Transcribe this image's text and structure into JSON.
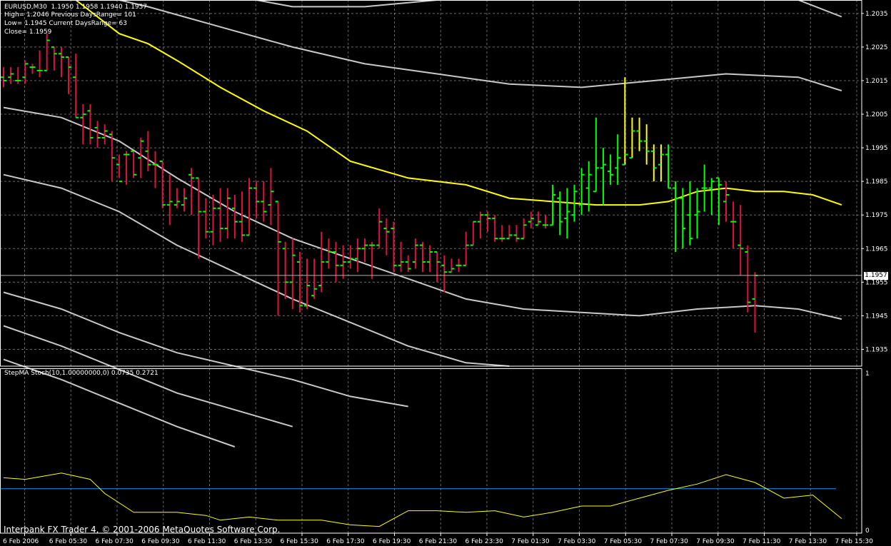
{
  "header": {
    "symbol_line": "EURUSD,M30  1.1950 1.1958 1.1940 1.1957",
    "high_line": "High= 1.2046 Previous DaysRange= 101",
    "low_line": "Low= 1.1945 Current DaysRange= 63",
    "close_line": "Close= 1.1959"
  },
  "indicator": {
    "title": "StepMA Stoch(10,1.00000000,0) 0.0735 0.2721"
  },
  "footer": {
    "copyright": "Interbank FX Trader 4, © 2001-2006 MetaQuotes Software Corp."
  },
  "current_price": "1.1957",
  "colors": {
    "background": "#000000",
    "grid": "#c0c0c0",
    "bull": "#00ff00",
    "bear": "#dc143c",
    "neutral": "#ffff00",
    "bands": "#c8c8c8",
    "ma": "#ffff00",
    "stoch": "#ffff00",
    "level": "#1e90ff"
  },
  "chart_data": [
    {
      "type": "ohlc",
      "price_labels": [
        "1.2035",
        "1.2025",
        "1.2015",
        "1.2005",
        "1.1995",
        "1.1985",
        "1.1975",
        "1.1965",
        "1.1955",
        "1.1945",
        "1.1935"
      ],
      "time_labels": [
        "6 Feb 2006",
        "6 Feb 05:30",
        "6 Feb 07:30",
        "6 Feb 09:30",
        "6 Feb 11:30",
        "6 Feb 13:30",
        "6 Feb 15:30",
        "6 Feb 17:30",
        "6 Feb 19:30",
        "6 Feb 21:30",
        "6 Feb 23:30",
        "7 Feb 01:30",
        "7 Feb 03:30",
        "7 Feb 05:30",
        "7 Feb 07:30",
        "7 Feb 09:30",
        "7 Feb 11:30",
        "7 Feb 13:30",
        "7 Feb 15:30"
      ],
      "ylim": [
        1.193,
        1.2039
      ],
      "bars": [
        [
          1.2016,
          1.2019,
          1.2013,
          1.2015,
          "bear"
        ],
        [
          1.2016,
          1.2019,
          1.2014,
          1.2017,
          "bear"
        ],
        [
          1.2015,
          1.2019,
          1.2014,
          1.2015,
          "bear"
        ],
        [
          1.2016,
          1.2021,
          1.2014,
          1.202,
          "bear"
        ],
        [
          1.2019,
          1.202,
          1.2017,
          1.2019,
          "bear"
        ],
        [
          1.2018,
          1.2024,
          1.2016,
          1.2018,
          "bear"
        ],
        [
          1.2018,
          1.2029,
          1.2018,
          1.2027,
          "bear"
        ],
        [
          1.2025,
          1.2025,
          1.2018,
          1.2023,
          "bear"
        ],
        [
          1.2023,
          1.2025,
          1.2016,
          1.2022,
          "bear"
        ],
        [
          1.2022,
          1.2022,
          1.2011,
          1.2019,
          "bear"
        ],
        [
          1.2016,
          1.2023,
          1.2004,
          1.2004,
          "bear"
        ],
        [
          1.2004,
          1.2008,
          1.1996,
          1.2005,
          "bear"
        ],
        [
          1.2006,
          1.2008,
          1.1996,
          1.1998,
          "bear"
        ],
        [
          1.2001,
          1.2003,
          1.1995,
          1.1998,
          "bear"
        ],
        [
          1.1998,
          1.2002,
          1.1996,
          1.2,
          "bear"
        ],
        [
          1.1999,
          1.2,
          1.1985,
          1.1992,
          "bear"
        ],
        [
          1.199,
          1.1993,
          1.1986,
          1.1985,
          "bear"
        ],
        [
          1.1993,
          1.1994,
          1.1984,
          1.1993,
          "bear"
        ],
        [
          1.1994,
          1.1994,
          1.1986,
          1.1987,
          "bear"
        ],
        [
          1.1992,
          1.1998,
          1.1986,
          1.1997,
          "bear"
        ],
        [
          1.1994,
          1.2,
          1.1988,
          1.199,
          "bear"
        ],
        [
          1.199,
          1.1994,
          1.1983,
          1.199,
          "bear"
        ],
        [
          1.1991,
          1.1991,
          1.1977,
          1.1978,
          "bear"
        ],
        [
          1.1978,
          1.1987,
          1.1972,
          1.1979,
          "bear"
        ],
        [
          1.1978,
          1.1983,
          1.1977,
          1.1979,
          "bear"
        ],
        [
          1.1978,
          1.1983,
          1.1976,
          1.198,
          "bear"
        ],
        [
          1.1987,
          1.1989,
          1.1975,
          1.1986,
          "bear"
        ],
        [
          1.1986,
          1.1986,
          1.1962,
          1.1976,
          "bear"
        ],
        [
          1.1976,
          1.198,
          1.1968,
          1.197,
          "bear"
        ],
        [
          1.197,
          1.1981,
          1.1966,
          1.1977,
          "bear"
        ],
        [
          1.1977,
          1.1983,
          1.1967,
          1.1971,
          "bear"
        ],
        [
          1.1971,
          1.1983,
          1.1968,
          1.198,
          "bear"
        ],
        [
          1.1977,
          1.1981,
          1.1968,
          1.1973,
          "bear"
        ],
        [
          1.1973,
          1.1982,
          1.1967,
          1.1969,
          "bear"
        ],
        [
          1.1969,
          1.1986,
          1.1969,
          1.1983,
          "bear"
        ],
        [
          1.1983,
          1.1985,
          1.1974,
          1.1979,
          "bear"
        ],
        [
          1.1979,
          1.1985,
          1.1973,
          1.1976,
          "bear"
        ],
        [
          1.1978,
          1.1989,
          1.1972,
          1.1982,
          "bear"
        ],
        [
          1.1979,
          1.1979,
          1.1945,
          1.1967,
          "bear"
        ],
        [
          1.1965,
          1.1967,
          1.195,
          1.1955,
          "bear"
        ],
        [
          1.1955,
          1.1968,
          1.1947,
          1.1963,
          "bear"
        ],
        [
          1.1961,
          1.1964,
          1.1946,
          1.1948,
          "bear"
        ],
        [
          1.1948,
          1.1962,
          1.1947,
          1.1954,
          "bear"
        ],
        [
          1.1951,
          1.1962,
          1.195,
          1.1953,
          "bear"
        ],
        [
          1.1954,
          1.197,
          1.1952,
          1.1961,
          "bear"
        ],
        [
          1.1961,
          1.1968,
          1.1959,
          1.1964,
          "bear"
        ],
        [
          1.1964,
          1.1967,
          1.1955,
          1.196,
          "bear"
        ],
        [
          1.196,
          1.1966,
          1.1956,
          1.1961,
          "bear"
        ],
        [
          1.1961,
          1.1966,
          1.1959,
          1.1962,
          "bear"
        ],
        [
          1.1962,
          1.1968,
          1.1958,
          1.1965,
          "bear"
        ],
        [
          1.1965,
          1.1968,
          1.1961,
          1.1966,
          "bear"
        ],
        [
          1.1966,
          1.1967,
          1.1956,
          1.1966,
          "bear"
        ],
        [
          1.1966,
          1.1977,
          1.1965,
          1.1973,
          "bear"
        ],
        [
          1.1971,
          1.1974,
          1.1963,
          1.197,
          "bear"
        ],
        [
          1.1971,
          1.1973,
          1.1958,
          1.196,
          "bear"
        ],
        [
          1.196,
          1.1967,
          1.1958,
          1.1961,
          "bear"
        ],
        [
          1.1961,
          1.1963,
          1.1958,
          1.1959,
          "bear"
        ],
        [
          1.1961,
          1.1968,
          1.1959,
          1.1966,
          "bear"
        ],
        [
          1.1966,
          1.1967,
          1.1958,
          1.1961,
          "bear"
        ],
        [
          1.1961,
          1.1966,
          1.1958,
          1.1964,
          "bear"
        ],
        [
          1.1964,
          1.1964,
          1.1955,
          1.1961,
          "bear"
        ],
        [
          1.196,
          1.1963,
          1.1952,
          1.1958,
          "bear"
        ],
        [
          1.1958,
          1.1962,
          1.1958,
          1.1959,
          "bear"
        ],
        [
          1.196,
          1.1962,
          1.1958,
          1.196,
          "bear"
        ],
        [
          1.196,
          1.197,
          1.196,
          1.1966,
          "bear"
        ],
        [
          1.1966,
          1.1973,
          1.1966,
          1.1973,
          "bear"
        ],
        [
          1.1973,
          1.1976,
          1.1968,
          1.1975,
          "bear"
        ],
        [
          1.1975,
          1.1976,
          1.197,
          1.1974,
          "bear"
        ],
        [
          1.1974,
          1.1975,
          1.1967,
          1.1968,
          "bear"
        ],
        [
          1.1968,
          1.1972,
          1.1967,
          1.1968,
          "bear"
        ],
        [
          1.1968,
          1.1972,
          1.1968,
          1.1969,
          "bear"
        ],
        [
          1.1969,
          1.1972,
          1.1967,
          1.1968,
          "bear"
        ],
        [
          1.1968,
          1.1974,
          1.1968,
          1.1972,
          "bear"
        ],
        [
          1.1973,
          1.1976,
          1.1971,
          1.1974,
          "bear"
        ],
        [
          1.1972,
          1.1976,
          1.1972,
          1.1973,
          "bear"
        ],
        [
          1.1972,
          1.1975,
          1.1971,
          1.1972,
          "bear"
        ],
        [
          1.1972,
          1.1984,
          1.1972,
          1.1981,
          "bull"
        ],
        [
          1.198,
          1.1982,
          1.1969,
          1.1973,
          "bull"
        ],
        [
          1.1974,
          1.1983,
          1.1968,
          1.1976,
          "bull"
        ],
        [
          1.1975,
          1.1984,
          1.1973,
          1.1982,
          "bull"
        ],
        [
          1.1978,
          1.1989,
          1.1975,
          1.1987,
          "bull"
        ],
        [
          1.1983,
          1.1991,
          1.1976,
          1.1987,
          "bull"
        ],
        [
          1.1982,
          1.2004,
          1.1982,
          1.1989,
          "bull"
        ],
        [
          1.1989,
          1.1995,
          1.1978,
          1.199,
          "bull"
        ],
        [
          1.1988,
          1.1993,
          1.1984,
          1.1987,
          "bull"
        ],
        [
          1.1989,
          1.1999,
          1.1984,
          1.1992,
          "bull"
        ],
        [
          1.199,
          1.2016,
          1.199,
          1.1993,
          "neutral"
        ],
        [
          1.1992,
          1.2004,
          1.1992,
          1.2,
          "neutral"
        ],
        [
          1.2,
          1.2004,
          1.1994,
          1.1997,
          "neutral"
        ],
        [
          1.1997,
          1.2002,
          1.199,
          1.1994,
          "neutral"
        ],
        [
          1.1994,
          1.1996,
          1.1985,
          1.1989,
          "neutral"
        ],
        [
          1.199,
          1.1996,
          1.1985,
          1.1993,
          "neutral"
        ],
        [
          1.1993,
          1.1996,
          1.1983,
          1.1983,
          "bull"
        ],
        [
          1.1983,
          1.1985,
          1.1964,
          1.198,
          "bull"
        ],
        [
          1.198,
          1.1983,
          1.1965,
          1.1971,
          "bull"
        ],
        [
          1.1975,
          1.1985,
          1.1966,
          1.1968,
          "bull"
        ],
        [
          1.1975,
          1.1983,
          1.1968,
          1.1976,
          "bull"
        ],
        [
          1.1983,
          1.199,
          1.1976,
          1.1983,
          "bull"
        ],
        [
          1.1983,
          1.1986,
          1.1975,
          1.1985,
          "bull"
        ],
        [
          1.1986,
          1.1986,
          1.1972,
          1.1984,
          "bull"
        ],
        [
          1.1979,
          1.1985,
          1.1973,
          1.1981,
          "bear"
        ],
        [
          1.1973,
          1.1979,
          1.1965,
          1.1973,
          "bear"
        ],
        [
          1.1966,
          1.1978,
          1.1957,
          1.1965,
          "bear"
        ],
        [
          1.1964,
          1.1966,
          1.1946,
          1.1949,
          "bear"
        ],
        [
          1.195,
          1.1958,
          1.194,
          1.1957,
          "bear"
        ]
      ],
      "series": [
        {
          "kind": "band",
          "x": [
            0,
            6,
            12,
            20,
            30,
            40,
            50,
            60,
            70,
            80,
            90,
            100,
            110,
            116
          ],
          "values": [
            1.2067,
            1.2062,
            1.2055,
            1.2049,
            1.2041,
            1.2037,
            1.2037,
            1.2039,
            1.2041,
            1.2041,
            1.2041,
            1.204,
            1.2039,
            1.2034
          ]
        },
        {
          "kind": "band",
          "x": [
            0,
            10,
            20,
            30,
            40,
            50,
            60,
            70,
            80,
            90,
            100,
            110,
            116
          ],
          "values": [
            1.2045,
            1.2042,
            1.2037,
            1.2031,
            1.2025,
            1.202,
            1.2017,
            1.2014,
            1.2013,
            1.2015,
            1.2017,
            1.2016,
            1.2012
          ]
        },
        {
          "kind": "band",
          "x": [
            0,
            8,
            16,
            24,
            32,
            40,
            48,
            56,
            64,
            72,
            80,
            88,
            96,
            104,
            110,
            116
          ],
          "values": [
            1.2007,
            1.2004,
            1.1997,
            1.1986,
            1.1976,
            1.1968,
            1.1962,
            1.1956,
            1.195,
            1.1947,
            1.1946,
            1.1945,
            1.1947,
            1.1948,
            1.1947,
            1.1944
          ]
        },
        {
          "kind": "band",
          "x": [
            0,
            8,
            16,
            24,
            32,
            40,
            48,
            56,
            64,
            70
          ],
          "values": [
            1.1987,
            1.1983,
            1.1976,
            1.1966,
            1.1958,
            1.195,
            1.1943,
            1.1936,
            1.1931,
            1.193
          ]
        },
        {
          "kind": "band",
          "x": [
            0,
            8,
            16,
            24,
            32,
            40,
            48,
            56
          ],
          "values": [
            1.1952,
            1.1947,
            1.194,
            1.1934,
            1.193,
            1.1926,
            1.1921,
            1.1918
          ]
        },
        {
          "kind": "band",
          "x": [
            0,
            8,
            16,
            24,
            32,
            40
          ],
          "values": [
            1.1942,
            1.1936,
            1.1929,
            1.1922,
            1.1917,
            1.1912
          ]
        },
        {
          "kind": "band",
          "x": [
            0,
            8,
            16,
            24,
            32
          ],
          "values": [
            1.1932,
            1.1926,
            1.1919,
            1.1912,
            1.1906
          ]
        },
        {
          "kind": "ma",
          "x": [
            0,
            10,
            16,
            20,
            24,
            30,
            36,
            42,
            48,
            56,
            64,
            70,
            76,
            82,
            88,
            92,
            96,
            100,
            104,
            108,
            112,
            116
          ],
          "values": [
            1.2046,
            1.2039,
            1.2029,
            1.2026,
            1.2021,
            1.2013,
            1.2006,
            1.2,
            1.1991,
            1.1986,
            1.1984,
            1.198,
            1.1979,
            1.1978,
            1.1978,
            1.1979,
            1.1982,
            1.1983,
            1.1982,
            1.1982,
            1.1981,
            1.1978
          ]
        }
      ]
    },
    {
      "type": "line",
      "y_tick_labels": [
        "1",
        "0"
      ],
      "ylim": [
        0,
        1
      ],
      "level": 0.26,
      "series": [
        {
          "x": [
            0,
            3,
            8,
            12,
            14,
            18,
            20,
            24,
            28,
            30,
            34,
            38,
            44,
            48,
            52,
            56,
            60,
            64,
            68,
            72,
            76,
            80,
            84,
            88,
            92,
            96,
            100,
            104,
            108,
            112,
            116
          ],
          "values": [
            0.33,
            0.32,
            0.36,
            0.32,
            0.23,
            0.11,
            0.11,
            0.11,
            0.09,
            0.06,
            0.08,
            0.06,
            0.06,
            0.03,
            0.02,
            0.12,
            0.12,
            0.11,
            0.12,
            0.08,
            0.11,
            0.15,
            0.15,
            0.2,
            0.25,
            0.29,
            0.35,
            0.3,
            0.2,
            0.22,
            0.07
          ]
        }
      ]
    }
  ]
}
